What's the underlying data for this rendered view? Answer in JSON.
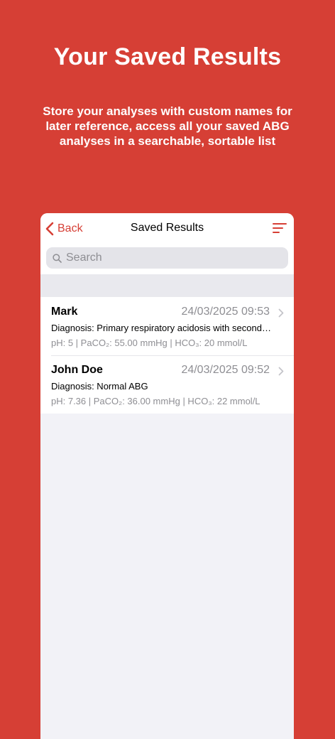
{
  "headline": "Your Saved Results",
  "subtext": "Store your analyses with custom names for later reference, access all your saved ABG analyses in a searchable, sortable list",
  "colors": {
    "accent": "#D63F35",
    "secondary_text": "#8E8E93",
    "list_background": "#F2F2F7"
  },
  "navbar": {
    "back_label": "Back",
    "title": "Saved Results",
    "back_icon": "chevron-left-icon",
    "sort_icon": "sort-lines-icon"
  },
  "search": {
    "placeholder": "Search",
    "value": "",
    "icon": "search-icon"
  },
  "results": [
    {
      "name": "Mark",
      "date": "24/03/2025 09:53",
      "diagnosis": "Diagnosis: Primary respiratory acidosis with secondary metabolic compensation",
      "values": "pH: 5 | PaCO₂: 55.00 mmHg | HCO₃: 20 mmol/L"
    },
    {
      "name": "John Doe",
      "date": "24/03/2025 09:52",
      "diagnosis": "Diagnosis: Normal ABG",
      "values": "pH: 7.36 | PaCO₂: 36.00 mmHg | HCO₃: 22 mmol/L"
    }
  ]
}
